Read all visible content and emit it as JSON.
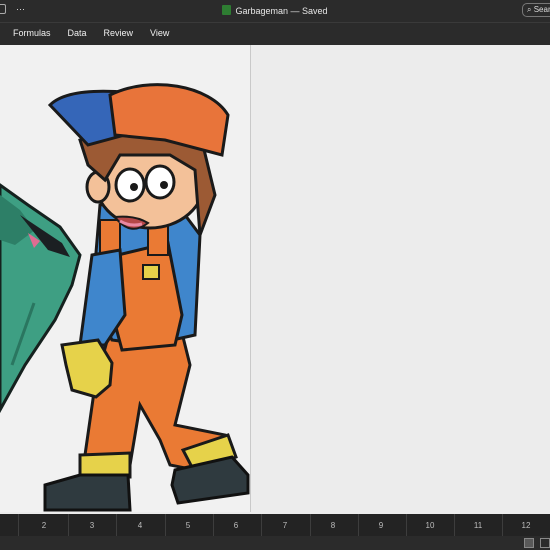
{
  "window": {
    "title": "Garbageman — Saved",
    "more_glyph": "···",
    "search_placeholder": "Sear"
  },
  "ribbon": {
    "tabs": [
      "Formulas",
      "Data",
      "Review",
      "View"
    ]
  },
  "ruler": {
    "labels": [
      "2",
      "3",
      "4",
      "5",
      "6",
      "7",
      "8",
      "9",
      "10",
      "11",
      "12"
    ]
  },
  "colors": {
    "cap_blue": "#3566b8",
    "cap_orange": "#e8743a",
    "shirt_blue": "#3f86cc",
    "overalls_orange": "#ea7a34",
    "glove_yellow": "#e6d24a",
    "boots": "#2f3a3f",
    "bin_green": "#3e9f83"
  }
}
